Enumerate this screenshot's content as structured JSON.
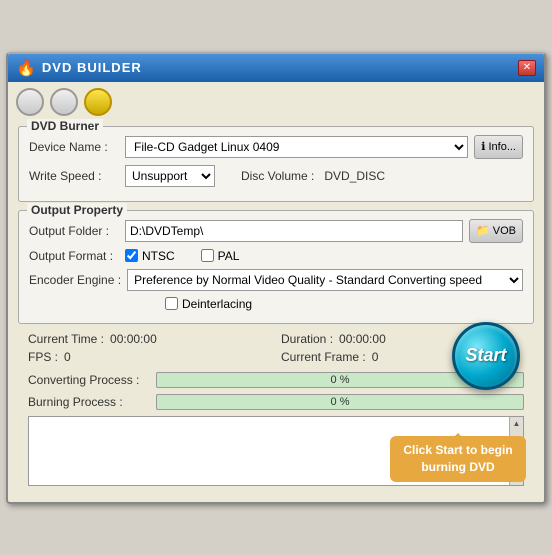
{
  "window": {
    "title": "DVD BUILDER",
    "title_icon": "🔥",
    "close_label": "✕"
  },
  "controls": {
    "circle1": "",
    "circle2": "",
    "circle3": ""
  },
  "dvd_burner": {
    "group_label": "DVD Burner",
    "device_name_label": "Device Name :",
    "device_name_value": "File-CD Gadget  Linux   0409",
    "info_button": "Info...",
    "write_speed_label": "Write Speed :",
    "write_speed_value": "Unsupport",
    "disc_volume_label": "Disc Volume :",
    "disc_volume_value": "DVD_DISC"
  },
  "output_property": {
    "group_label": "Output Property",
    "output_folder_label": "Output Folder :",
    "output_folder_value": "D:\\DVDTemp\\",
    "vob_button": "VOB",
    "output_format_label": "Output Format :",
    "ntsc_label": "NTSC",
    "pal_label": "PAL",
    "encoder_engine_label": "Encoder Engine :",
    "encoder_value": "Preference by Normal Video Quality - Standard Converting speed",
    "deinterlacing_label": "Deinterlacing"
  },
  "stats": {
    "current_time_label": "Current Time :",
    "current_time_value": "00:00:00",
    "duration_label": "Duration :",
    "duration_value": "00:00:00",
    "fps_label": "FPS :",
    "fps_value": "0",
    "current_frame_label": "Current Frame :",
    "current_frame_value": "0"
  },
  "progress": {
    "converting_label": "Converting Process :",
    "converting_percent": "0 %",
    "burning_label": "Burning Process :",
    "burning_percent": "0 %"
  },
  "start_button": {
    "label": "Start"
  },
  "tooltip": {
    "text": "Click Start to begin burning DVD"
  }
}
